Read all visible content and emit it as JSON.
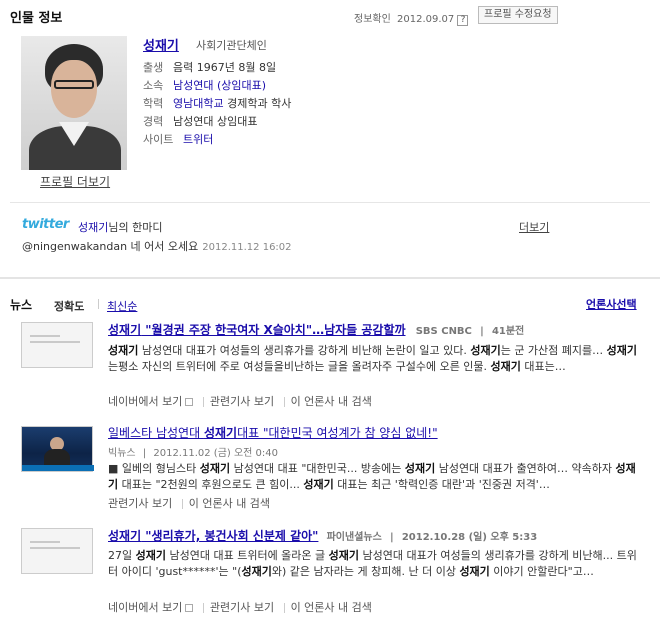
{
  "header": {
    "title": "인물 정보",
    "info_date_label": "정보확인",
    "info_date": "2012.09.07",
    "help_icon": "?",
    "edit_request": "프로필 수정요청"
  },
  "person": {
    "name": "성재기",
    "category": "사회기관단체인",
    "birth_key": "출생",
    "birth_val": "음력 1967년 8월 8일",
    "org_key": "소속",
    "org_val": "남성연대 (상임대표)",
    "edu_key": "학력",
    "edu_school": "영남대학교",
    "edu_rest": "경제학과 학사",
    "career_key": "경력",
    "career_val": "남성연대 상임대표",
    "site_key": "사이트",
    "site_val": "트위터",
    "profile_more": "프로필 더보기"
  },
  "twitter": {
    "logo": "twitter",
    "name": "성재기",
    "suffix": "님의 한마디",
    "more": "더보기",
    "message": "@ningenwakandan 네 어서 오세요",
    "timestamp": "2012.11.12 16:02"
  },
  "news": {
    "title": "뉴스",
    "sort_accuracy": "정확도",
    "sort_latest": "최신순",
    "press_select": "언론사선택",
    "articles": [
      {
        "title_kw": "성재기",
        "title_rest": " \"월경권 주장 한국여자 X슬아치\"…남자들 공감할까",
        "source": "SBS CNBC",
        "time": "41분전",
        "body_1": "성재기",
        "body_2": " 남성연대 대표가 여성들의 생리휴가를 강하게 비난해 논란이 일고 있다. ",
        "body_3": "성재기",
        "body_4": "는 군 가산점 폐지를… ",
        "body_5": "성재기",
        "body_6": "는평소 자신의 트위터에 주로 여성들을비난하는 글을 올려자주 구설수에 오른 인물. ",
        "body_7": "성재기",
        "body_8": " 대표는…",
        "link_naver": "네이버에서 보기",
        "link_related": "관련기사 보기",
        "link_press": "이 언론사 내 검색"
      },
      {
        "title_pre": "일베스타 남성연대 ",
        "title_kw": "성재기",
        "title_rest": "대표 \"대한민국 여성계가 참 양심 없네!\"",
        "source": "빅뉴스",
        "time": "2012.11.02 (금) 오전 0:40",
        "body_1": "■ 일베의 형님스타 ",
        "body_2": "성재기",
        "body_3": " 남성연대 대표 \"대한민국... 방송에는 ",
        "body_4": "성재기",
        "body_5": " 남성연대 대표가 출연하여… 약속하자 ",
        "body_6": "성재기",
        "body_7": " 대표는 \"2천원의 후원으로도 큰 힘이... ",
        "body_8": "성재기",
        "body_9": " 대표는 최근 '학력인증 대란'과 '진중권 저격'…",
        "link_related": "관련기사 보기",
        "link_press": "이 언론사 내 검색"
      },
      {
        "title_kw": "성재기",
        "title_rest": " \"생리휴가, 봉건사회 신분제 같아\"",
        "source": "파이낸셜뉴스",
        "time": "2012.10.28 (일) 오후 5:33",
        "body_1": "27일 ",
        "body_2": "성재기",
        "body_3": " 남성연대 대표 트위터에 올라온 글 ",
        "body_4": "성재기",
        "body_5": " 남성연대 대표가 여성들의 생리휴가를 강하게 비난해... 트위터 아이디 'gust******'는 \"(",
        "body_6": "성재기",
        "body_7": "와) 같은 남자라는 게 창피해. 난 더 이상 ",
        "body_8": "성재기",
        "body_9": " 이야기 안할란다\"고…",
        "link_naver": "네이버에서 보기",
        "link_related": "관련기사 보기",
        "link_press": "이 언론사 내 검색"
      }
    ]
  }
}
